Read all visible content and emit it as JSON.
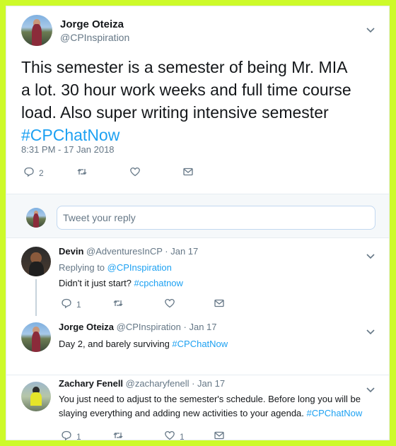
{
  "main_tweet": {
    "name": "Jorge Oteiza",
    "handle": "@CPInspiration",
    "text": "This semester is a semester of being Mr. MIA a lot.  30 hour work weeks and full time course load. Also super writing intensive semester ",
    "hashtag": "#CPChatNow",
    "timestamp": "8:31 PM - 17 Jan 2018",
    "reply_count": "2"
  },
  "reply_box": {
    "placeholder": "Tweet your reply"
  },
  "replies": [
    {
      "name": "Devin",
      "handle": "@AdventuresInCP",
      "date": "· Jan 17",
      "replying_to_label": "Replying to ",
      "replying_to_handle": "@CPInspiration",
      "text": "Didn't it just start? ",
      "hashtag": "#cpchatnow",
      "reply_count": "1",
      "like_count": ""
    },
    {
      "name": "Jorge Oteiza",
      "handle": "@CPInspiration",
      "date": "· Jan 17",
      "text": "Day 2, and barely surviving ",
      "hashtag": "#CPChatNow"
    },
    {
      "name": "Zachary Fenell",
      "handle": "@zacharyfenell",
      "date": "· Jan 17",
      "text_line1": "You just need to adjust to the semester's schedule. Before long you will be",
      "text_line2": "slaying everything and adding new activities to your agenda. ",
      "hashtag": "#CPChatNow",
      "reply_count": "1",
      "like_count": "1"
    }
  ],
  "icons": [
    "reply-icon",
    "retweet-icon",
    "like-icon",
    "message-icon",
    "chevron-down-icon"
  ],
  "colors": {
    "accent": "#1da1f2",
    "muted": "#657786",
    "border_bg": "#cdfa2a"
  }
}
